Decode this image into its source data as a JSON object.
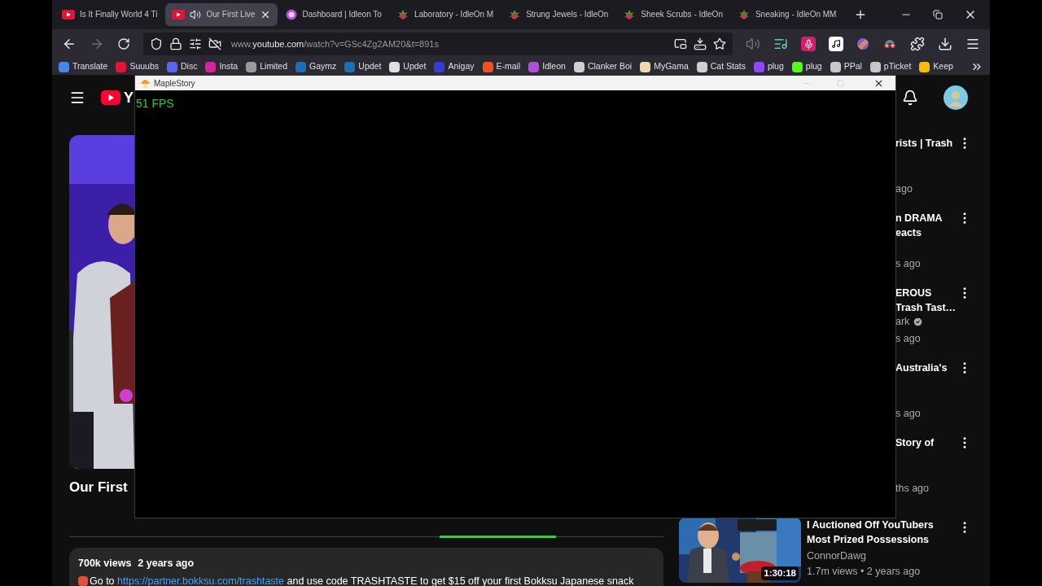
{
  "tabs": [
    {
      "title": "Is It Finally World 4 Ti",
      "kind": "video",
      "selected": false,
      "audio": false
    },
    {
      "title": "Our First Live",
      "kind": "video",
      "selected": true,
      "audio": true
    },
    {
      "title": "Dashboard | Idleon To",
      "kind": "dashboard",
      "selected": false,
      "audio": false
    },
    {
      "title": "Laboratory - IdleOn M",
      "kind": "wiki",
      "selected": false,
      "audio": false
    },
    {
      "title": "Strung Jewels - IdleOn",
      "kind": "wiki",
      "selected": false,
      "audio": false
    },
    {
      "title": "Sheek Scrubs - IdleOn",
      "kind": "wiki",
      "selected": false,
      "audio": false
    },
    {
      "title": "Sneaking - IdleOn MM",
      "kind": "wiki",
      "selected": false,
      "audio": false
    }
  ],
  "nav": {
    "forward_disabled": true,
    "url_prefix": "www.",
    "url_domain": "youtube.com",
    "url_path": "/watch?v=GSc4Zg2AM20&t=891s"
  },
  "bookmarks": [
    {
      "label": "Translate",
      "color": "#4a86e8"
    },
    {
      "label": "Suuubs",
      "color": "#e5133a"
    },
    {
      "label": "Disc",
      "color": "#5865f2"
    },
    {
      "label": "Insta",
      "color": "#d6249f"
    },
    {
      "label": "Limited",
      "color": "#9a9a9a"
    },
    {
      "label": "Gaymz",
      "color": "#1b6fb5"
    },
    {
      "label": "Updet",
      "color": "#1b6fb5"
    },
    {
      "label": "Updet",
      "color": "#e0e0e0"
    },
    {
      "label": "Anigay",
      "color": "#3a3adb"
    },
    {
      "label": "E-mail",
      "color": "#f25022"
    },
    {
      "label": "Idleon",
      "color": "#b04fd6"
    },
    {
      "label": "Clanker Boi",
      "color": "#cfcfcf"
    },
    {
      "label": "MyGama",
      "color": "#e8d9b0"
    },
    {
      "label": "Cat Stats",
      "color": "#d0d0d0"
    },
    {
      "label": "plug",
      "color": "#9146ff"
    },
    {
      "label": "plug",
      "color": "#53fc18"
    },
    {
      "label": "PPal",
      "color": "#c8c8c8"
    },
    {
      "label": "pTicket",
      "color": "#c8c8c8"
    },
    {
      "label": "Keep",
      "color": "#fbbc04"
    }
  ],
  "window": {
    "title": "MapleStory",
    "fps": "51 FPS"
  },
  "masthead": {
    "logo_text": "Y"
  },
  "video": {
    "title": "Our First",
    "views": "700k views",
    "age": "2 years ago",
    "text_before": "Go to ",
    "link": "https://partner.bokksu.com/trashtaste",
    "text_after": " and use code TRASHTASTE to get $15 off your first Bokksu Japanese snack"
  },
  "recommended": [
    {
      "title_lines": [
        "rists | Trash"
      ],
      "age": "ago"
    },
    {
      "title_lines": [
        "n DRAMA",
        "eacts"
      ],
      "age": "s ago"
    },
    {
      "title_lines": [
        "EROUS",
        "Trash Tast…"
      ],
      "channel": "ark",
      "verified": true,
      "age": "s ago"
    },
    {
      "title_lines": [
        "Australia's"
      ],
      "age": "s ago"
    },
    {
      "title_lines": [
        "Story of"
      ],
      "age": "ths ago"
    }
  ],
  "featured": {
    "title": "I Auctioned Off YouTubers Most Prized Possessions",
    "channel": "ConnorDawg",
    "meta": "1.7m views • 2 years ago",
    "duration": "1:30:18"
  }
}
